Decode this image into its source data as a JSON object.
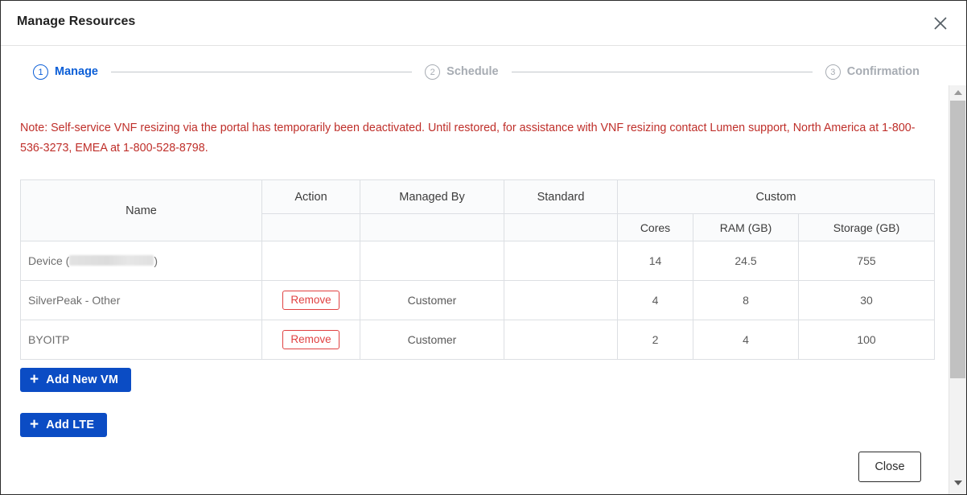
{
  "modal": {
    "title": "Manage Resources",
    "close_icon": "close-x-icon"
  },
  "stepper": {
    "steps": [
      {
        "number": "1",
        "label": "Manage",
        "state": "active"
      },
      {
        "number": "2",
        "label": "Schedule",
        "state": "inactive"
      },
      {
        "number": "3",
        "label": "Confirmation",
        "state": "inactive"
      }
    ]
  },
  "note": {
    "text": "Note: Self-service VNF resizing via the portal has temporarily been deactivated. Until restored, for assistance with VNF resizing contact Lumen support, North America at 1-800-536-3273, EMEA at 1-800-528-8798.",
    "color": "#bf2f2a"
  },
  "table": {
    "group_headers": {
      "name": "Name",
      "action": "Action",
      "managed_by": "Managed By",
      "standard": "Standard",
      "custom": "Custom"
    },
    "sub_headers": {
      "cores": "Cores",
      "ram": "RAM (GB)",
      "storage": "Storage (GB)"
    },
    "rows": [
      {
        "name_prefix": "Device (",
        "name_redacted": true,
        "name_suffix": ")",
        "action": "",
        "managed_by": "",
        "standard": "",
        "cores": "14",
        "ram": "24.5",
        "storage": "755"
      },
      {
        "name_prefix": "SilverPeak - Other",
        "name_redacted": false,
        "name_suffix": "",
        "action": "Remove",
        "managed_by": "Customer",
        "standard": "",
        "cores": "4",
        "ram": "8",
        "storage": "30"
      },
      {
        "name_prefix": "BYOITP",
        "name_redacted": false,
        "name_suffix": "",
        "action": "Remove",
        "managed_by": "Customer",
        "standard": "",
        "cores": "2",
        "ram": "4",
        "storage": "100"
      }
    ]
  },
  "actions": {
    "add_vm_plus": "+",
    "add_vm_label": "Add New VM",
    "add_lte_plus": "+",
    "add_lte_label": "Add LTE",
    "close_label": "Close",
    "primary_color": "#0b4cc4",
    "remove_color": "#e04141"
  },
  "scrollbar": {
    "up_icon": "caret-up-icon",
    "down_icon": "caret-down-icon"
  }
}
